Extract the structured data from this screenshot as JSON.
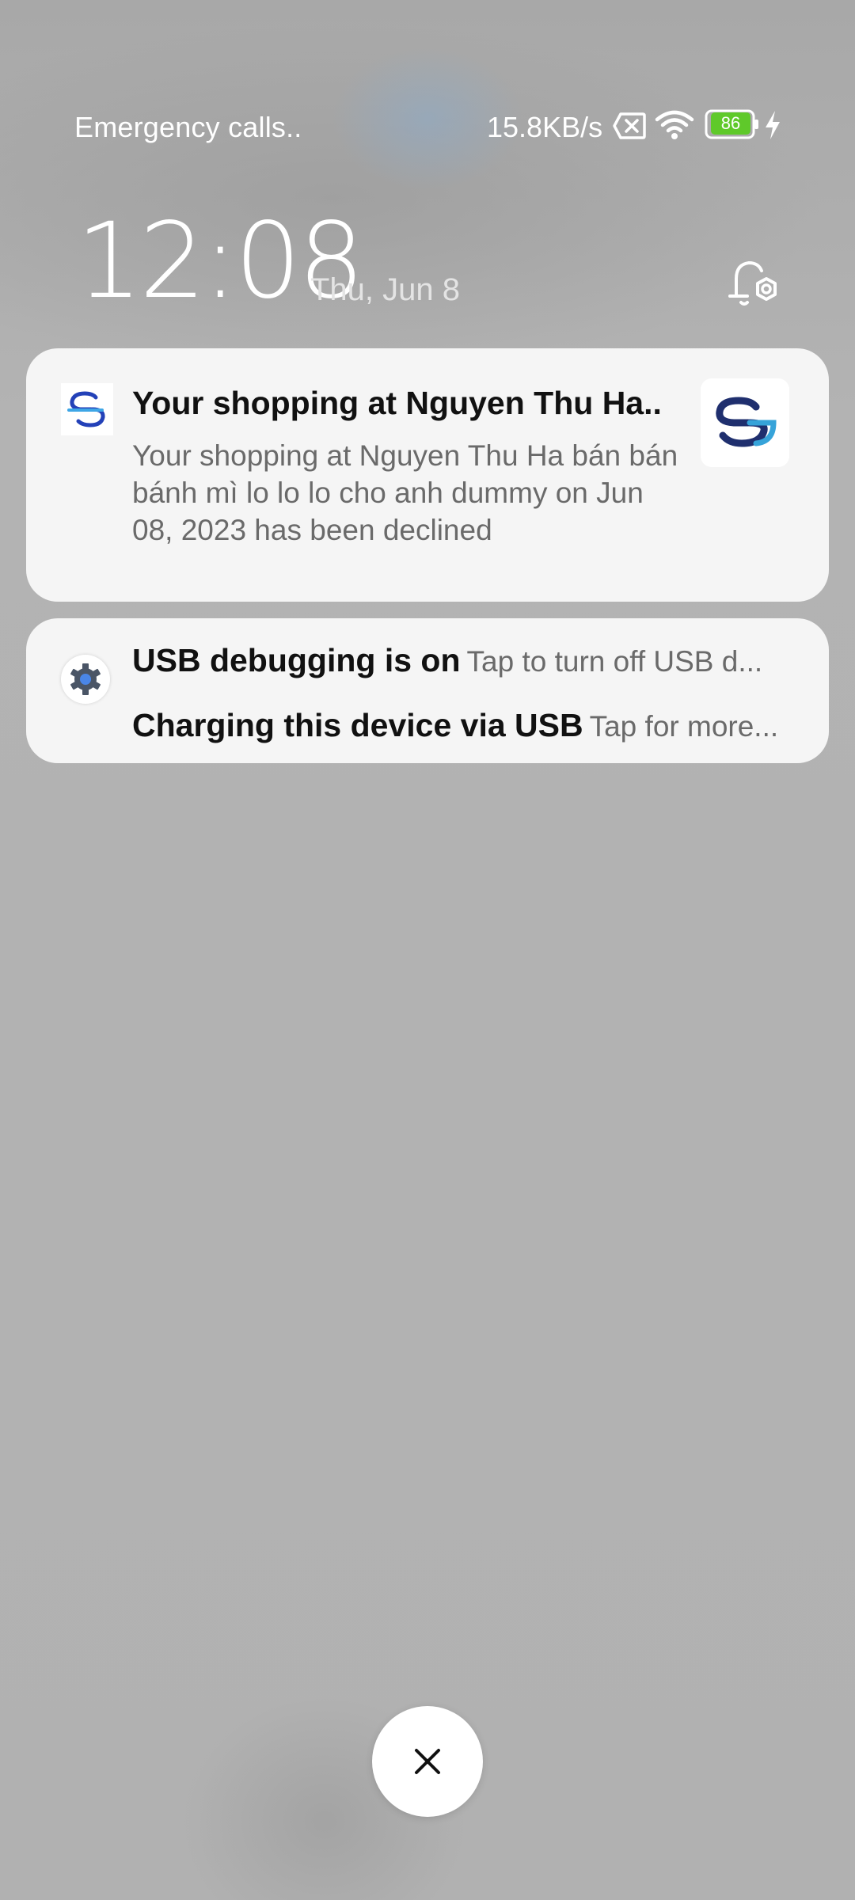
{
  "status_bar": {
    "carrier_text": "Emergency calls..",
    "network_speed": "15.8KB/s",
    "battery_level": "86",
    "icons": [
      "no-sim-icon",
      "wifi-icon",
      "battery-icon",
      "charging-bolt-icon"
    ],
    "battery_color": "#5fc92a"
  },
  "lock_screen": {
    "time": "12:08",
    "date": "Thu, Jun 8",
    "settings_icon": "bell-settings-icon"
  },
  "notifications": [
    {
      "app_icon": "sg-app-icon",
      "title": "Your shopping at Nguyen Thu Ha..",
      "body": "Your shopping at Nguyen Thu Ha bán bán bánh mì lo lo lo cho anh dummy on Jun 08, 2023 has been declined",
      "large_icon": "sg-logo-icon"
    },
    {
      "app_icon": "settings-gear-icon",
      "rows": [
        {
          "title": "USB debugging is on",
          "subtitle": "Tap to turn off USB d..."
        },
        {
          "title": "Charging this device via USB",
          "subtitle": "Tap for more..."
        }
      ]
    }
  ],
  "clear_all": {
    "icon": "close-icon"
  }
}
